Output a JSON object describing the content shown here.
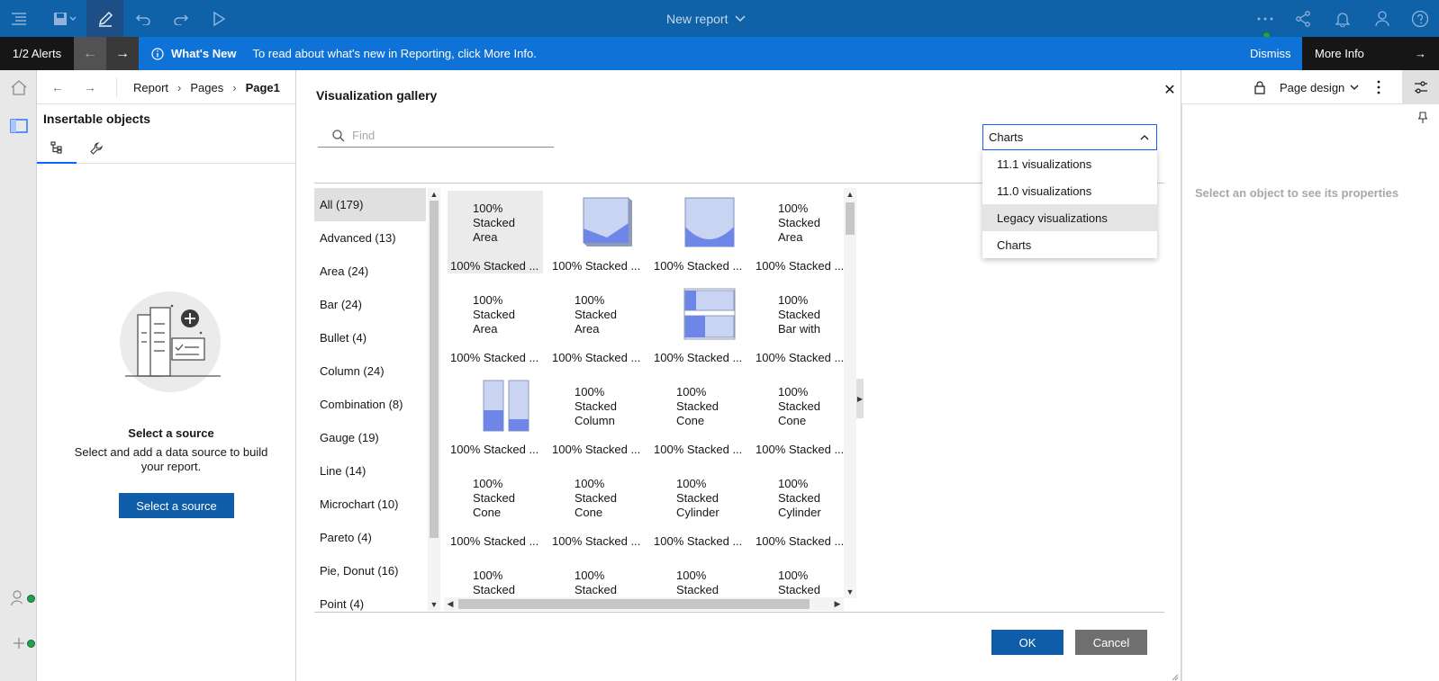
{
  "topbar": {
    "title": "New report",
    "icons": [
      "menu-icon",
      "save-icon",
      "edit-icon",
      "undo-icon",
      "redo-icon",
      "play-icon",
      "overflow-icon",
      "share-icon",
      "bell-icon",
      "user-icon",
      "help-icon"
    ]
  },
  "alert": {
    "count": "1/2 Alerts",
    "heading": "What's New",
    "message": "To read about what's new in Reporting, click More Info.",
    "dismiss": "Dismiss",
    "more_info": "More Info"
  },
  "nav": {
    "breadcrumb": [
      "Report",
      "Pages",
      "Page1"
    ],
    "page_design": "Page design"
  },
  "left_panel": {
    "title": "Insertable objects",
    "source_title": "Select a source",
    "source_desc": "Select and add a data source to build your report.",
    "source_button": "Select a source"
  },
  "right_panel": {
    "hint": "Select an object to see its properties"
  },
  "modal": {
    "title": "Visualization gallery",
    "find_placeholder": "Find",
    "select_value": "Charts",
    "dropdown_options": [
      "11.1 visualizations",
      "11.0 visualizations",
      "Legacy visualizations",
      "Charts"
    ],
    "categories": [
      "All (179)",
      "Advanced (13)",
      "Area (24)",
      "Bar (24)",
      "Bullet (4)",
      "Column (24)",
      "Combination (8)",
      "Gauge (19)",
      "Line (14)",
      "Microchart (10)",
      "Pareto (4)",
      "Pie, Donut (16)",
      "Point (4)"
    ],
    "tile_caption": "100% Stacked ...",
    "tile_thumbs": [
      {
        "kind": "text",
        "lines": [
          "100%",
          "Stacked",
          "Area"
        ]
      },
      {
        "kind": "area-v"
      },
      {
        "kind": "area-u"
      },
      {
        "kind": "text",
        "lines": [
          "100%",
          "Stacked",
          "Area"
        ]
      },
      {
        "kind": "text",
        "lines": [
          "100%",
          "Stacked",
          "Area"
        ]
      },
      {
        "kind": "text",
        "lines": [
          "100%",
          "Stacked",
          "Area"
        ]
      },
      {
        "kind": "bar"
      },
      {
        "kind": "text",
        "lines": [
          "100%",
          "Stacked",
          "Bar with"
        ]
      },
      {
        "kind": "column"
      },
      {
        "kind": "text",
        "lines": [
          "100%",
          "Stacked",
          "Column"
        ]
      },
      {
        "kind": "text",
        "lines": [
          "100%",
          "Stacked",
          "Cone"
        ]
      },
      {
        "kind": "text",
        "lines": [
          "100%",
          "Stacked",
          "Cone"
        ]
      },
      {
        "kind": "text",
        "lines": [
          "100%",
          "Stacked",
          "Cone"
        ]
      },
      {
        "kind": "text",
        "lines": [
          "100%",
          "Stacked",
          "Cone"
        ]
      },
      {
        "kind": "text",
        "lines": [
          "100%",
          "Stacked",
          "Cylinder"
        ]
      },
      {
        "kind": "text",
        "lines": [
          "100%",
          "Stacked",
          "Cylinder"
        ]
      },
      {
        "kind": "text",
        "lines": [
          "100%",
          "Stacked",
          ""
        ]
      },
      {
        "kind": "text",
        "lines": [
          "100%",
          "Stacked",
          ""
        ]
      },
      {
        "kind": "text",
        "lines": [
          "100%",
          "Stacked",
          ""
        ]
      },
      {
        "kind": "text",
        "lines": [
          "100%",
          "Stacked",
          ""
        ]
      }
    ],
    "ok": "OK",
    "cancel": "Cancel"
  },
  "colors": {
    "topbar": "#0f62a8",
    "alertbar": "#0f72d6",
    "primary_button": "#0f5ca8",
    "chart_fill": "#6e86e8",
    "chart_light": "#c8d4f2"
  }
}
